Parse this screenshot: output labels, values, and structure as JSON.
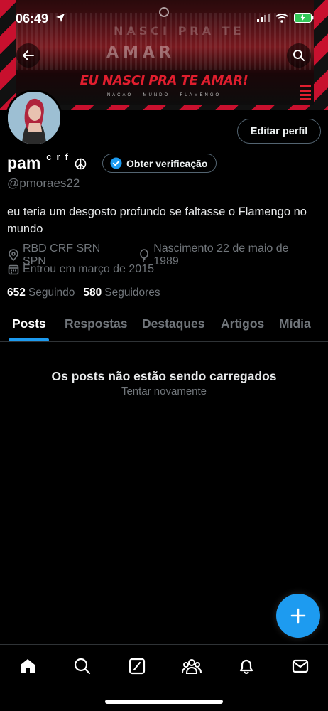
{
  "status_bar": {
    "time": "06:49"
  },
  "banner": {
    "slogan": "EU NASCI PRA TE AMAR!",
    "stands_text": "AMAR",
    "stands_text_top": "NASCI PRA TE",
    "sponsors": "NAÇÃO · MUNDO · FLAMENGO"
  },
  "profile": {
    "display_name": "pam",
    "display_name_suffix": "crf",
    "handle": "@pmoraes22",
    "bio": "eu teria um desgosto profundo se faltasse o Flamengo no mundo",
    "location": "RBD CRF SRN SPN",
    "birth": "Nascimento 22 de maio de 1989",
    "joined": "Entrou em março de 2015",
    "following_count": "652",
    "following_label": "Seguindo",
    "followers_count": "580",
    "followers_label": "Seguidores"
  },
  "buttons": {
    "edit_profile": "Editar perfil",
    "get_verified": "Obter verificação"
  },
  "tabs": [
    {
      "label": "Posts"
    },
    {
      "label": "Respostas"
    },
    {
      "label": "Destaques"
    },
    {
      "label": "Artigos"
    },
    {
      "label": "Mídia"
    }
  ],
  "empty_state": {
    "title": "Os posts não estão sendo carregados",
    "retry": "Tentar novamente"
  },
  "colors": {
    "accent": "#1d9bf0",
    "background": "#000000",
    "muted": "#71767b",
    "banner_red": "#e01e2e"
  },
  "icons": [
    "back-arrow-icon",
    "search-icon",
    "location-icon",
    "balloon-icon",
    "calendar-icon",
    "peace-icon",
    "verified-badge-icon",
    "plus-icon",
    "home-icon",
    "explore-icon",
    "grok-icon",
    "communities-icon",
    "notifications-icon",
    "messages-icon"
  ]
}
